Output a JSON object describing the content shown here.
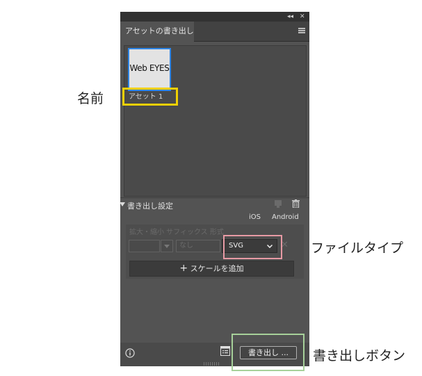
{
  "panel": {
    "tab_title": "アセットの書き出し",
    "top_controls": [
      "◂◂",
      "✕"
    ],
    "asset": {
      "thumb_text": "Web EYES",
      "label": "アセット 1"
    },
    "section_title": "書き出し設定",
    "platforms": [
      "iOS",
      "Android"
    ],
    "settings_header": "拡大・縮小 サフィックス 形式",
    "suffix_placeholder": "なし",
    "format_value": "SVG",
    "add_scale_label": "スケールを追加",
    "export_button": "書き出し ..."
  },
  "annotations": {
    "name": "名前",
    "file_type": "ファイルタイプ",
    "export_button": "書き出しボタン"
  },
  "colors": {
    "panel_bg": "#535353",
    "selection_blue": "#2f86e6",
    "name_highlight": "#f0d000",
    "filetype_highlight": "#e79aa4",
    "export_highlight": "#a7d19a"
  }
}
